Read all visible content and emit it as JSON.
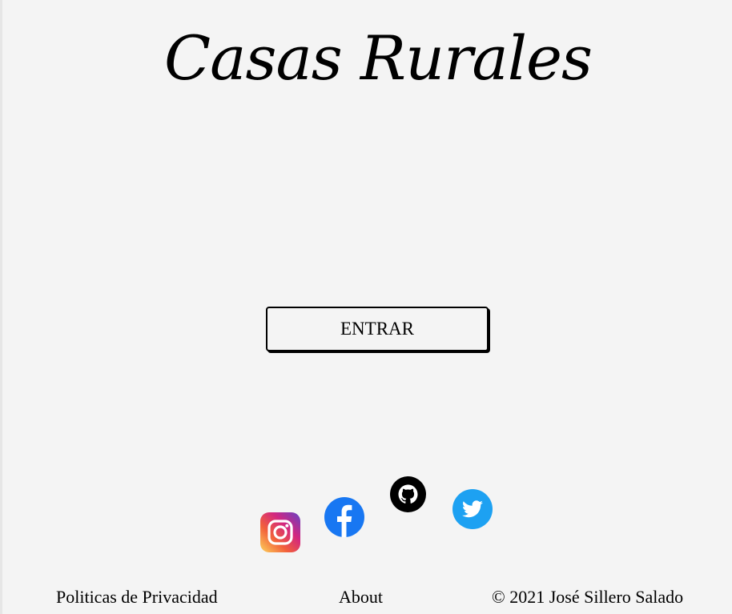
{
  "header": {
    "title": "Casas Rurales"
  },
  "main": {
    "enter_label": "ENTRAR"
  },
  "social": {
    "icons": [
      "instagram-icon",
      "facebook-icon",
      "github-icon",
      "twitter-icon"
    ],
    "colors": {
      "facebook": "#1877f2",
      "twitter": "#1da1f2",
      "github": "#000000"
    }
  },
  "footer": {
    "privacy_label": "Politicas de Privacidad",
    "about_label": "About",
    "copyright": "© 2021 José Sillero Salado"
  }
}
